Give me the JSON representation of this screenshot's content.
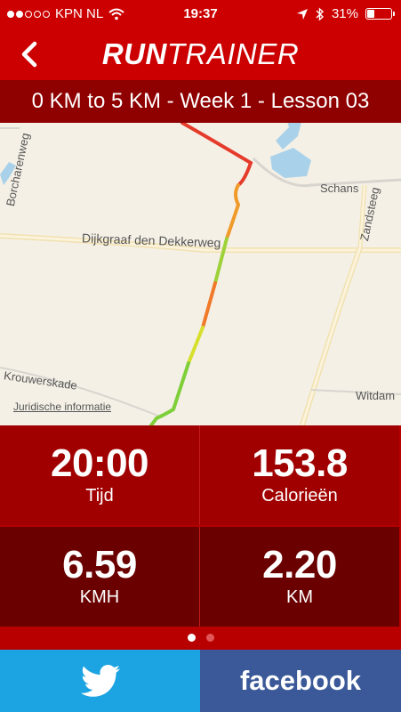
{
  "status_bar": {
    "carrier": "KPN NL",
    "time": "19:37",
    "battery": "31%",
    "battery_level": 0.31,
    "signal_bars_filled": 2,
    "signal_bars_total": 5
  },
  "navbar": {
    "brand_bold": "RUN",
    "brand_thin": "TRAINER",
    "back_icon": "chevron-left-icon"
  },
  "lesson_title": "0 KM to 5 KM - Week 1 - Lesson 03",
  "map": {
    "streets": [
      "Borcharenweg",
      "Schans",
      "Zandsteeg",
      "Dijkgraaf den Dekkerweg",
      "Krouwerskade",
      "Witdam"
    ],
    "legal_link": "Juridische informatie"
  },
  "stats": [
    {
      "value": "20:00",
      "label": "Tijd"
    },
    {
      "value": "153.8",
      "label": "Calorieën"
    },
    {
      "value": "6.59",
      "label": "KMH"
    },
    {
      "value": "2.20",
      "label": "KM"
    }
  ],
  "pager": {
    "pages": 2,
    "current": 1
  },
  "share": {
    "twitter_icon": "twitter-bird-icon",
    "facebook_label": "facebook"
  },
  "colors": {
    "brand_red": "#cc0000",
    "twitter_blue": "#1ca3e1",
    "facebook_blue": "#3b5998"
  }
}
